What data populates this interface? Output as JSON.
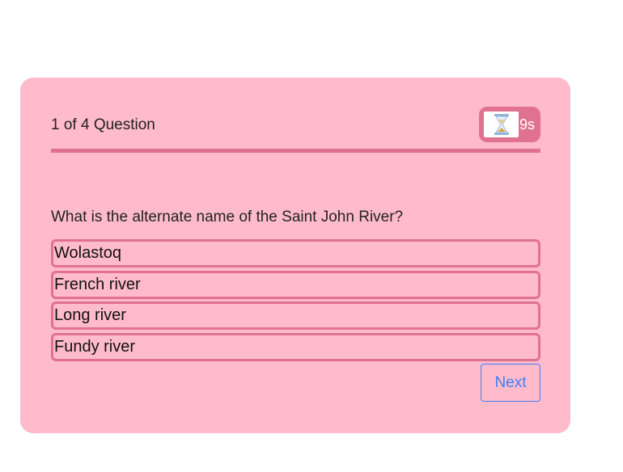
{
  "quiz": {
    "counter": "1 of 4 Question",
    "timer": {
      "icon": "hourglass-icon",
      "value": "9s"
    },
    "question": "What is the alternate name of the Saint John River?",
    "options": [
      "Wolastoq",
      "French river",
      "Long river",
      "Fundy river"
    ],
    "next_label": "Next"
  },
  "colors": {
    "card_background": "#ffbbcb",
    "accent": "#e0728f",
    "next_button": "#3b82f6"
  }
}
